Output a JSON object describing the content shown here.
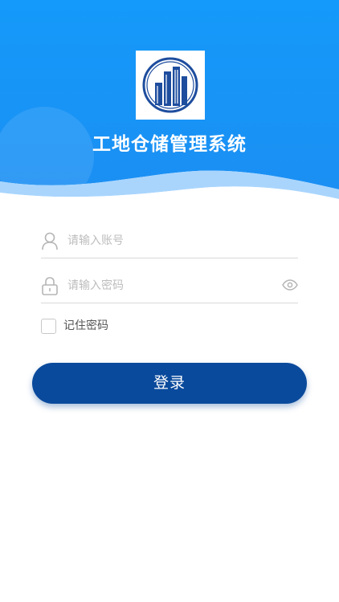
{
  "app": {
    "title": "工地仓储管理系统"
  },
  "form": {
    "account": {
      "placeholder": "请输入账号",
      "value": "",
      "icon": "user-icon"
    },
    "password": {
      "placeholder": "请输入密码",
      "value": "",
      "icon": "lock-icon",
      "toggle_icon": "eye-icon"
    },
    "remember": {
      "label": "记住密码",
      "checked": false
    },
    "login_label": "登录"
  },
  "colors": {
    "header_blue": "#1a96f8",
    "wave_light": "#a9d5fd",
    "button": "#0a4a9c",
    "logo_blue": "#1e4d9e"
  }
}
